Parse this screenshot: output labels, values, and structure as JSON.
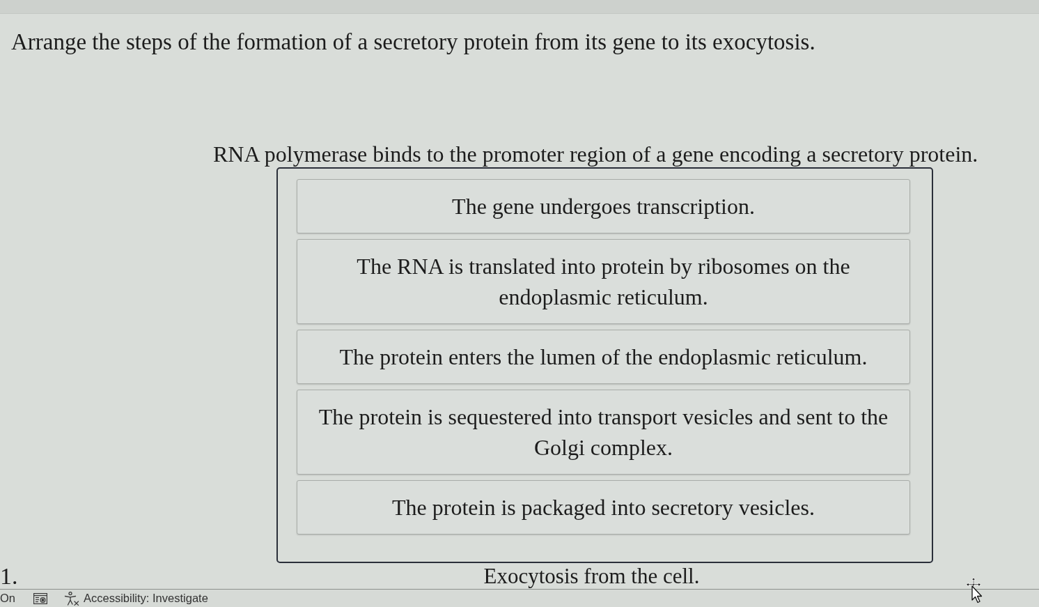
{
  "question": "Arrange the steps of the formation of a secretory protein from its gene to its exocytosis.",
  "first_step": "RNA polymerase binds to the promoter region of a gene encoding a secretory protein.",
  "steps": [
    "The gene undergoes transcription.",
    "The RNA is translated into protein by ribosomes on the endoplasmic reticulum.",
    "The protein enters the lumen of the endoplasmic reticulum.",
    "The protein is sequestered into transport vesicles and sent to the Golgi complex.",
    "The protein is packaged into secretory vesicles."
  ],
  "last_step": "Exocytosis from the cell.",
  "item_number": "1.",
  "status_bar": {
    "left_text": "On",
    "accessibility": "Accessibility: Investigate"
  }
}
